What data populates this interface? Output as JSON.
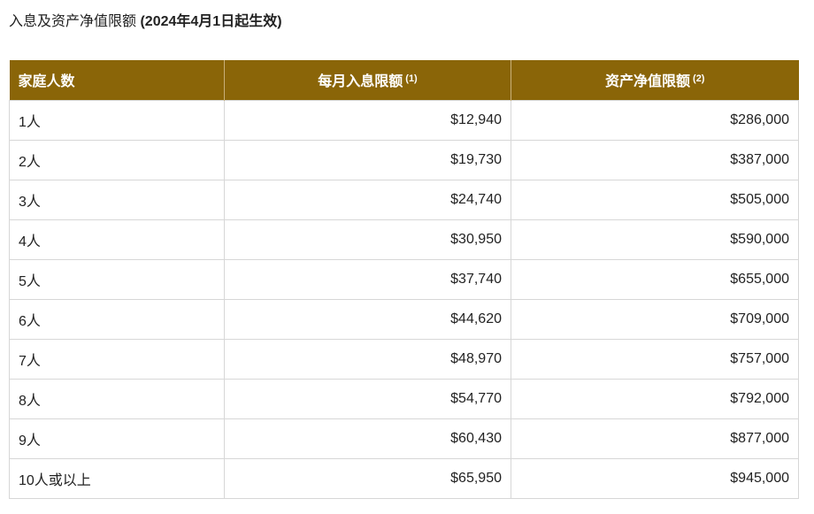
{
  "heading": {
    "title": "入息及资产净值限额",
    "note": "(2024年4月1日起生效)"
  },
  "table": {
    "headers": {
      "household": "家庭人数",
      "income": "每月入息限额",
      "income_note": "(1)",
      "assets": "资产净值限额",
      "assets_note": "(2)"
    },
    "rows": [
      {
        "household": "1人",
        "income": "$12,940",
        "assets": "$286,000"
      },
      {
        "household": "2人",
        "income": "$19,730",
        "assets": "$387,000"
      },
      {
        "household": "3人",
        "income": "$24,740",
        "assets": "$505,000"
      },
      {
        "household": "4人",
        "income": "$30,950",
        "assets": "$590,000"
      },
      {
        "household": "5人",
        "income": "$37,740",
        "assets": "$655,000"
      },
      {
        "household": "6人",
        "income": "$44,620",
        "assets": "$709,000"
      },
      {
        "household": "7人",
        "income": "$48,970",
        "assets": "$757,000"
      },
      {
        "household": "8人",
        "income": "$54,770",
        "assets": "$792,000"
      },
      {
        "household": "9人",
        "income": "$60,430",
        "assets": "$877,000"
      },
      {
        "household": "10人或以上",
        "income": "$65,950",
        "assets": "$945,000"
      }
    ]
  },
  "colors": {
    "header_background": "#8a6508",
    "header_text": "#ffffff",
    "grid_border": "#d7d7d7"
  }
}
